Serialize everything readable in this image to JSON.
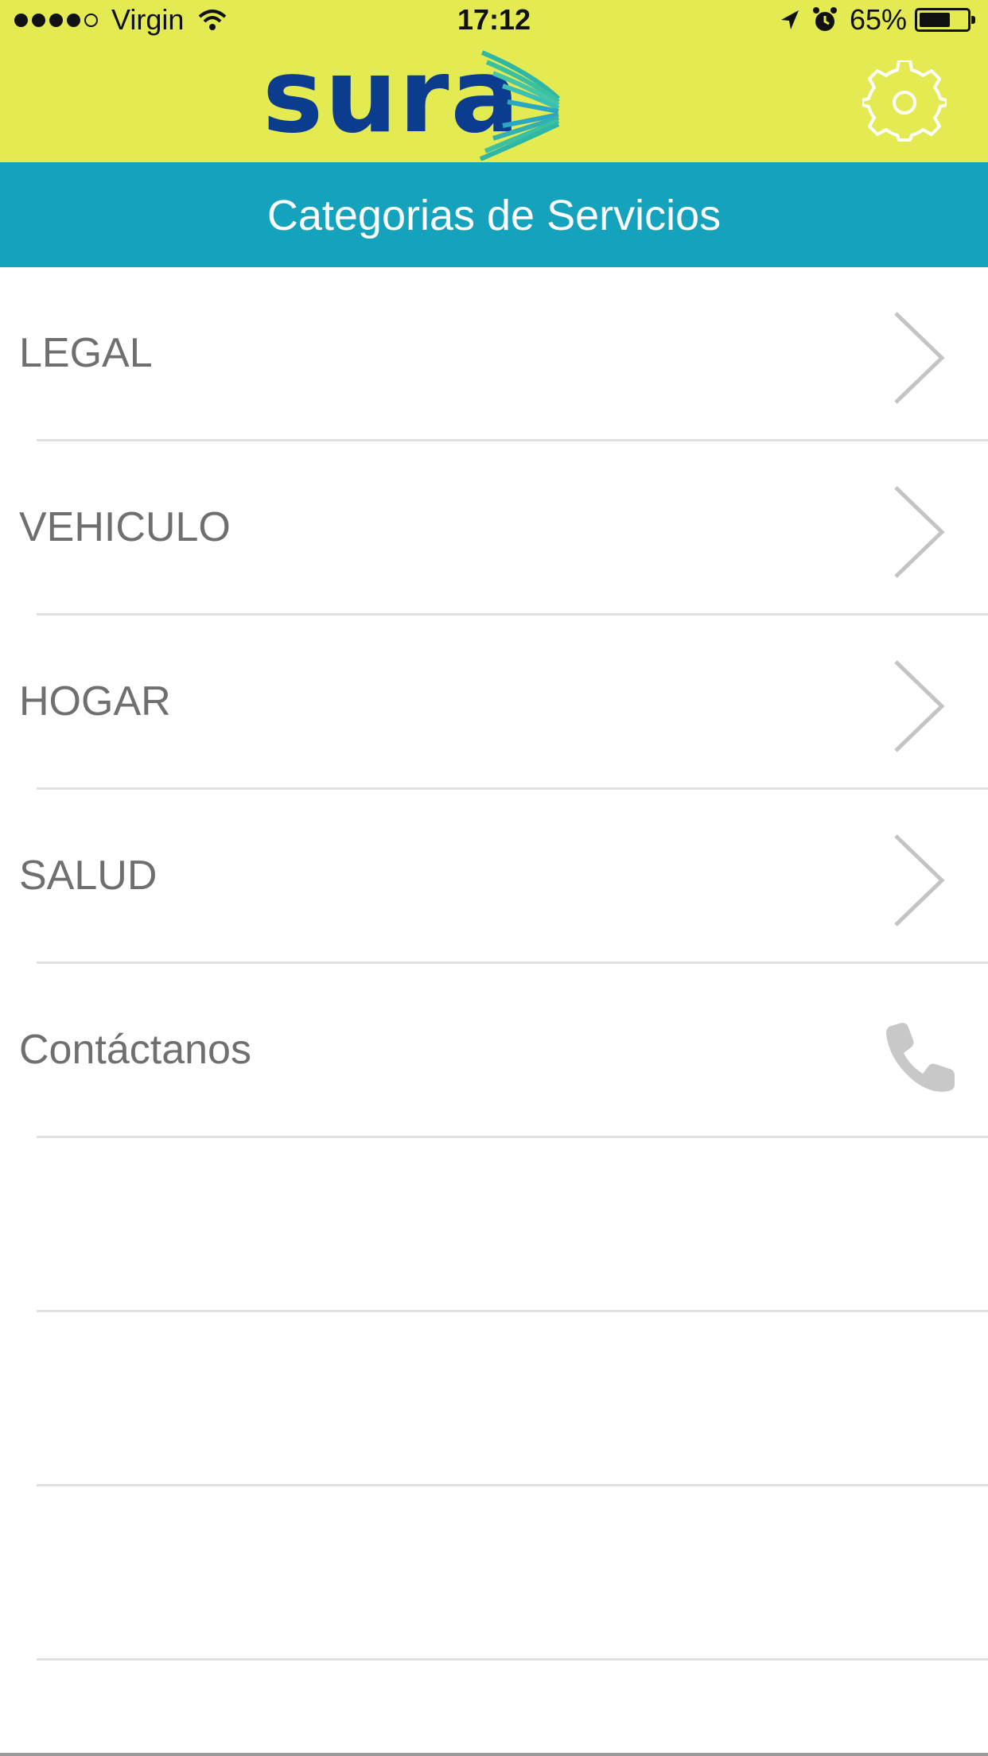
{
  "status_bar": {
    "carrier": "Virgin",
    "time": "17:12",
    "battery": "65%",
    "battery_level": 0.65,
    "signal_bars": 4
  },
  "header": {
    "logo_text": "sura",
    "settings_icon": "gear-icon",
    "colors": {
      "header_bg": "#e3ea52",
      "logo": "#0c3c8e",
      "title_bg": "#14a2bd"
    }
  },
  "title": "Categorias de Servicios",
  "list": {
    "items": [
      {
        "label": "LEGAL",
        "icon": "chevron-right-icon"
      },
      {
        "label": "VEHICULO",
        "icon": "chevron-right-icon"
      },
      {
        "label": "HOGAR",
        "icon": "chevron-right-icon"
      },
      {
        "label": "SALUD",
        "icon": "chevron-right-icon"
      },
      {
        "label": "Contáctanos",
        "icon": "phone-icon"
      }
    ],
    "empty_rows": 3
  }
}
